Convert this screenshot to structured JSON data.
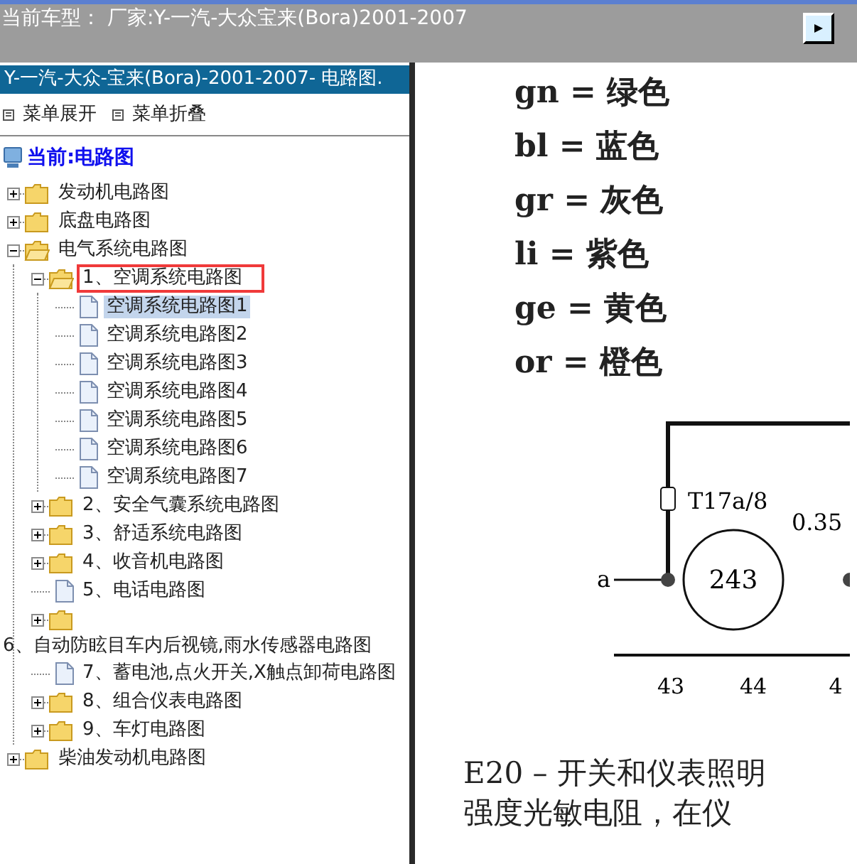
{
  "header": {
    "title": "当前车型： 厂家:Y-一汽-大众宝来(Bora)2001-2007"
  },
  "sidebar": {
    "heading": "Y-一汽-大众-宝来(Bora)-2001-2007- 电路图.",
    "actions": [
      {
        "label": "菜单展开"
      },
      {
        "label": "菜单折叠"
      }
    ],
    "current": "当前:电路图",
    "tree": [
      {
        "kind": "folder",
        "label": "发动机电路图",
        "expanded": false,
        "selected": false,
        "marked": false
      },
      {
        "kind": "folder",
        "label": "底盘电路图",
        "expanded": false,
        "selected": false,
        "marked": false
      },
      {
        "kind": "folder",
        "label": "电气系统电路图",
        "expanded": true,
        "selected": false,
        "marked": false,
        "children": [
          {
            "kind": "folder",
            "label": "1、空调系统电路图",
            "expanded": true,
            "selected": false,
            "marked": true,
            "children": [
              {
                "kind": "page",
                "label": "空调系统电路图1",
                "selected": true,
                "marked": false
              },
              {
                "kind": "page",
                "label": "空调系统电路图2",
                "selected": false,
                "marked": false
              },
              {
                "kind": "page",
                "label": "空调系统电路图3",
                "selected": false,
                "marked": false
              },
              {
                "kind": "page",
                "label": "空调系统电路图4",
                "selected": false,
                "marked": false
              },
              {
                "kind": "page",
                "label": "空调系统电路图5",
                "selected": false,
                "marked": false
              },
              {
                "kind": "page",
                "label": "空调系统电路图6",
                "selected": false,
                "marked": false
              },
              {
                "kind": "page",
                "label": "空调系统电路图7",
                "selected": false,
                "marked": false
              }
            ]
          },
          {
            "kind": "folder",
            "label": "2、安全气囊系统电路图",
            "expanded": false,
            "selected": false,
            "marked": false
          },
          {
            "kind": "folder",
            "label": "3、舒适系统电路图",
            "expanded": false,
            "selected": false,
            "marked": false
          },
          {
            "kind": "folder",
            "label": "4、收音机电路图",
            "expanded": false,
            "selected": false,
            "marked": false
          },
          {
            "kind": "page",
            "label": "5、电话电路图",
            "selected": false,
            "marked": false
          },
          {
            "kind": "folder-wrapped",
            "label": "6、自动防眩目车内后视镜,雨水传感器电路图",
            "expanded": false,
            "selected": false,
            "marked": false
          },
          {
            "kind": "page",
            "label": "7、蓄电池,点火开关,X触点卸荷电路图",
            "selected": false,
            "marked": false
          },
          {
            "kind": "folder",
            "label": "8、组合仪表电路图",
            "expanded": false,
            "selected": false,
            "marked": false
          },
          {
            "kind": "folder",
            "label": "9、车灯电路图",
            "expanded": false,
            "selected": false,
            "marked": false
          }
        ]
      },
      {
        "kind": "folder",
        "label": "柴油发动机电路图",
        "expanded": false,
        "selected": false,
        "marked": false
      }
    ]
  },
  "document": {
    "legend": [
      "gn = 绿色",
      "bl = 蓝色",
      "gr = 灰色",
      "li = 紫色",
      "ge = 黄色",
      "or = 橙色"
    ],
    "diagram": {
      "connector": "T17a/8",
      "wire": "0.35",
      "terminal": "a",
      "component": "243",
      "scale": [
        "43",
        "44",
        "4"
      ]
    },
    "caption": [
      "E20 – 开关和仪表照明",
      "强度光敏电阻，在仪"
    ]
  }
}
